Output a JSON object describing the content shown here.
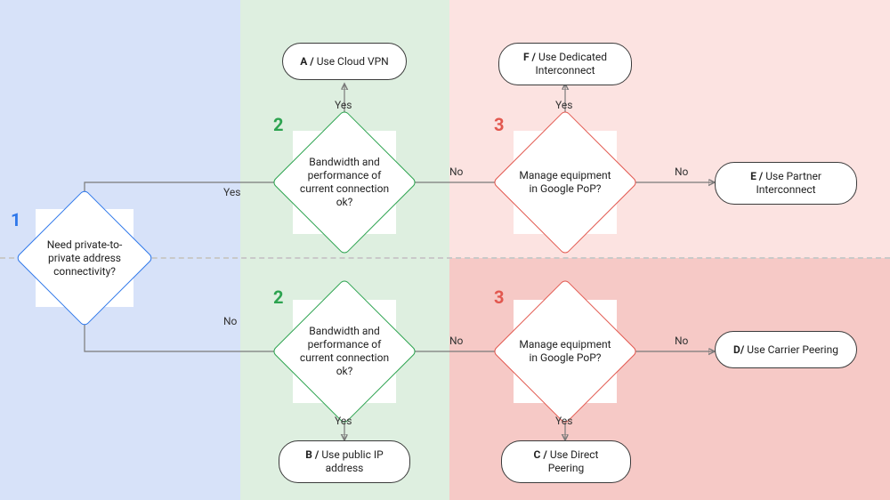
{
  "steps": {
    "one": "1",
    "two": "2",
    "three": "3"
  },
  "decisions": {
    "d1": "Need private-to-private address connectivity?",
    "d2a": "Bandwidth and performance of current connection ok?",
    "d2b": "Bandwidth and performance of current connection ok?",
    "d3a": "Manage equipment in Google PoP?",
    "d3b": "Manage equipment in Google PoP?"
  },
  "results": {
    "A": {
      "tag": "A / ",
      "text": "Use Cloud VPN"
    },
    "B": {
      "tag": "B / ",
      "text": "Use public IP address"
    },
    "C": {
      "tag": "C / ",
      "text": "Use Direct Peering"
    },
    "D": {
      "tag": "D/ ",
      "text": "Use Carrier Peering"
    },
    "E": {
      "tag": "E / ",
      "text": "Use Partner Interconnect"
    },
    "F": {
      "tag": "F / ",
      "text": "Use Dedicated Interconnect"
    }
  },
  "labels": {
    "yes": "Yes",
    "no": "No"
  }
}
